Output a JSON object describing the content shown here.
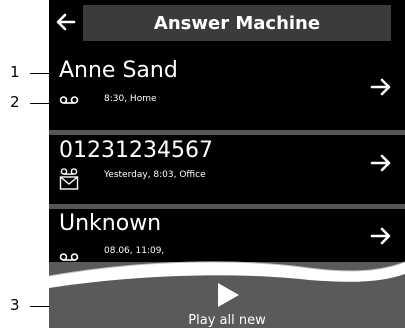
{
  "callouts": [
    "1",
    "2",
    "3"
  ],
  "header": {
    "title": "Answer Machine",
    "back_icon": "arrow-left-icon"
  },
  "messages": [
    {
      "caller": "Anne Sand",
      "details": "8:30, Home",
      "status_icon": "voicemail-icon",
      "open_icon": "arrow-right-icon"
    },
    {
      "caller": "01231234567",
      "details": "Yesterday, 8:03, Office",
      "status_icon": "new-voicemail-envelope-icon",
      "open_icon": "arrow-right-icon"
    },
    {
      "caller": "Unknown",
      "details": "08.06, 11:09,",
      "status_icon": "voicemail-icon",
      "open_icon": "arrow-right-icon"
    }
  ],
  "footer": {
    "play_label": "Play all new",
    "play_icon": "play-icon"
  },
  "colors": {
    "screen_bg": "#000000",
    "title_bar": "#3b3b3b",
    "separator": "#555555",
    "footer_bg": "#5a5a5a",
    "text": "#ffffff"
  }
}
